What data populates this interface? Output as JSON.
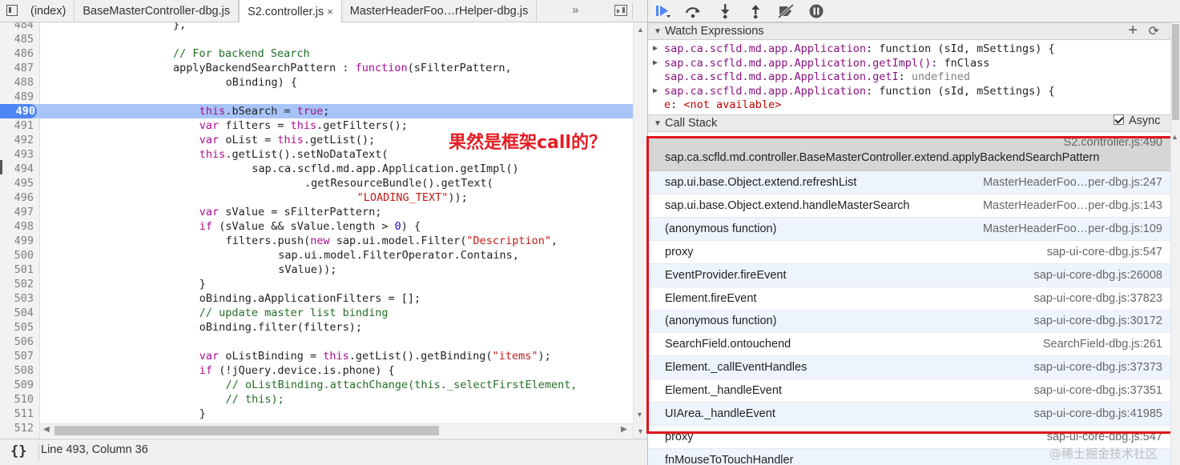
{
  "tabs": {
    "items": [
      {
        "label": "(index)",
        "active": false,
        "closable": false
      },
      {
        "label": "BaseMasterController-dbg.js",
        "active": false,
        "closable": false
      },
      {
        "label": "S2.controller.js",
        "active": true,
        "closable": true
      },
      {
        "label": "MasterHeaderFoo…rHelper-dbg.js",
        "active": false,
        "closable": false
      }
    ],
    "overflow": "»",
    "close_glyph": "×"
  },
  "code": {
    "current_line": 490,
    "lines": [
      {
        "n": "484",
        "indent": 20,
        "parts": [
          [
            "",
            "},"
          ]
        ]
      },
      {
        "n": "485",
        "indent": 0,
        "parts": []
      },
      {
        "n": "486",
        "indent": 20,
        "parts": [
          [
            "cmt",
            "// For backend Search"
          ]
        ]
      },
      {
        "n": "487",
        "indent": 20,
        "parts": [
          [
            "",
            "applyBackendSearchPattern : "
          ],
          [
            "kw",
            "function"
          ],
          [
            "",
            "(sFilterPattern,"
          ]
        ]
      },
      {
        "n": "488",
        "indent": 28,
        "parts": [
          [
            "",
            "oBinding) {"
          ]
        ]
      },
      {
        "n": "489",
        "indent": 0,
        "parts": []
      },
      {
        "n": "490",
        "indent": 24,
        "parts": [
          [
            "kw",
            "this"
          ],
          [
            "",
            ".bSearch = "
          ],
          [
            "kw",
            "true"
          ],
          [
            "",
            ";"
          ]
        ]
      },
      {
        "n": "491",
        "indent": 24,
        "parts": [
          [
            "kw",
            "var"
          ],
          [
            "",
            " filters = "
          ],
          [
            "kw",
            "this"
          ],
          [
            "",
            ".getFilters();"
          ]
        ]
      },
      {
        "n": "492",
        "indent": 24,
        "parts": [
          [
            "kw",
            "var"
          ],
          [
            "",
            " oList = "
          ],
          [
            "kw",
            "this"
          ],
          [
            "",
            ".getList();"
          ]
        ]
      },
      {
        "n": "493",
        "indent": 24,
        "parts": [
          [
            "kw",
            "this"
          ],
          [
            "",
            ".getList().setNoDataText("
          ]
        ]
      },
      {
        "n": "494",
        "indent": 32,
        "parts": [
          [
            "",
            "sap.ca.scfld.md.app.Application.getImpl()"
          ]
        ]
      },
      {
        "n": "495",
        "indent": 40,
        "parts": [
          [
            "",
            ".getResourceBundle().getText("
          ]
        ]
      },
      {
        "n": "496",
        "indent": 48,
        "parts": [
          [
            "str",
            "\"LOADING_TEXT\""
          ],
          [
            "",
            "));"
          ]
        ]
      },
      {
        "n": "497",
        "indent": 24,
        "parts": [
          [
            "kw",
            "var"
          ],
          [
            "",
            " sValue = sFilterPattern;"
          ]
        ]
      },
      {
        "n": "498",
        "indent": 24,
        "parts": [
          [
            "kw",
            "if"
          ],
          [
            "",
            " (sValue && sValue.length > "
          ],
          [
            "num",
            "0"
          ],
          [
            "",
            ") {"
          ]
        ]
      },
      {
        "n": "499",
        "indent": 28,
        "parts": [
          [
            "",
            "filters.push("
          ],
          [
            "kw",
            "new"
          ],
          [
            "",
            " sap.ui.model.Filter("
          ],
          [
            "str",
            "\"Description\""
          ],
          [
            "",
            ","
          ]
        ]
      },
      {
        "n": "500",
        "indent": 36,
        "parts": [
          [
            "",
            "sap.ui.model.FilterOperator.Contains,"
          ]
        ]
      },
      {
        "n": "501",
        "indent": 36,
        "parts": [
          [
            "",
            "sValue));"
          ]
        ]
      },
      {
        "n": "502",
        "indent": 24,
        "parts": [
          [
            "",
            "}"
          ]
        ]
      },
      {
        "n": "503",
        "indent": 24,
        "parts": [
          [
            "",
            "oBinding.aApplicationFilters = [];"
          ]
        ]
      },
      {
        "n": "504",
        "indent": 24,
        "parts": [
          [
            "cmt",
            "// update master list binding"
          ]
        ]
      },
      {
        "n": "505",
        "indent": 24,
        "parts": [
          [
            "",
            "oBinding.filter(filters);"
          ]
        ]
      },
      {
        "n": "506",
        "indent": 0,
        "parts": []
      },
      {
        "n": "507",
        "indent": 24,
        "parts": [
          [
            "kw",
            "var"
          ],
          [
            "",
            " oListBinding = "
          ],
          [
            "kw",
            "this"
          ],
          [
            "",
            ".getList().getBinding("
          ],
          [
            "str",
            "\"items\""
          ],
          [
            "",
            ");"
          ]
        ]
      },
      {
        "n": "508",
        "indent": 24,
        "parts": [
          [
            "kw",
            "if"
          ],
          [
            "",
            " (!jQuery.device.is.phone) {"
          ]
        ]
      },
      {
        "n": "509",
        "indent": 28,
        "parts": [
          [
            "cmt",
            "// oListBinding.attachChange(this._selectFirstElement,"
          ]
        ]
      },
      {
        "n": "510",
        "indent": 28,
        "parts": [
          [
            "cmt",
            "// this);"
          ]
        ]
      },
      {
        "n": "511",
        "indent": 24,
        "parts": [
          [
            "",
            "}"
          ]
        ]
      },
      {
        "n": "512",
        "indent": 24,
        "parts": [
          [
            "",
            "/"
          ]
        ]
      }
    ]
  },
  "annotation": "果然是框架call的？",
  "status": {
    "braces": "{}",
    "position": "Line 493, Column 36"
  },
  "debugger_toolbar": {
    "buttons": [
      {
        "name": "resume-icon"
      },
      {
        "name": "step-over-icon"
      },
      {
        "name": "step-into-icon"
      },
      {
        "name": "step-out-icon"
      },
      {
        "name": "deactivate-breakpoints-icon"
      },
      {
        "name": "pause-on-exceptions-icon"
      }
    ]
  },
  "watch": {
    "title": "Watch Expressions",
    "add_glyph": "+",
    "refresh_glyph": "⟳",
    "items": [
      {
        "expandable": true,
        "expr": "sap.ca.scfld.md.app.Application",
        "value": "function (sId, mSettings) {",
        "vtype": "v"
      },
      {
        "expandable": true,
        "expr": "sap.ca.scfld.md.app.Application.getImpl()",
        "value": "fnClass",
        "vtype": "v"
      },
      {
        "expandable": false,
        "expr": "sap.ca.scfld.md.app.Application.getI",
        "value": "undefined",
        "vtype": "u"
      },
      {
        "expandable": true,
        "expr": "sap.ca.scfld.md.app.Application",
        "value": "function (sId, mSettings) {",
        "vtype": "v"
      },
      {
        "expandable": false,
        "expr": "e",
        "value": "<not available>",
        "vtype": "n"
      }
    ]
  },
  "callstack": {
    "title": "Call Stack",
    "async_label": "Async",
    "async_checked": true,
    "frames": [
      {
        "fn": "sap.ca.scfld.md.controller.BaseMasterController.extend.applyBackendSearchPattern",
        "loc": "S2.controller.js:490",
        "selected": true
      },
      {
        "fn": "sap.ui.base.Object.extend.refreshList",
        "loc": "MasterHeaderFoo…per-dbg.js:247"
      },
      {
        "fn": "sap.ui.base.Object.extend.handleMasterSearch",
        "loc": "MasterHeaderFoo…per-dbg.js:143"
      },
      {
        "fn": "(anonymous function)",
        "loc": "MasterHeaderFoo…per-dbg.js:109"
      },
      {
        "fn": "proxy",
        "loc": "sap-ui-core-dbg.js:547"
      },
      {
        "fn": "EventProvider.fireEvent",
        "loc": "sap-ui-core-dbg.js:26008"
      },
      {
        "fn": "Element.fireEvent",
        "loc": "sap-ui-core-dbg.js:37823"
      },
      {
        "fn": "(anonymous function)",
        "loc": "sap-ui-core-dbg.js:30172"
      },
      {
        "fn": "SearchField.ontouchend",
        "loc": "SearchField-dbg.js:261"
      },
      {
        "fn": "Element._callEventHandles",
        "loc": "sap-ui-core-dbg.js:37373"
      },
      {
        "fn": "Element._handleEvent",
        "loc": "sap-ui-core-dbg.js:37351"
      },
      {
        "fn": "UIArea._handleEvent",
        "loc": "sap-ui-core-dbg.js:41985"
      },
      {
        "fn": "proxy",
        "loc": "sap-ui-core-dbg.js:547"
      },
      {
        "fn": "fnMouseToTouchHandler",
        "loc": ""
      }
    ]
  },
  "watermark": "@稀土掘金技术社区",
  "colors": {
    "highlight_line": "#a8c4f7",
    "breakpoint": "#4e86f5",
    "annotation": "#e51c23",
    "red_box": "#e2121f"
  }
}
